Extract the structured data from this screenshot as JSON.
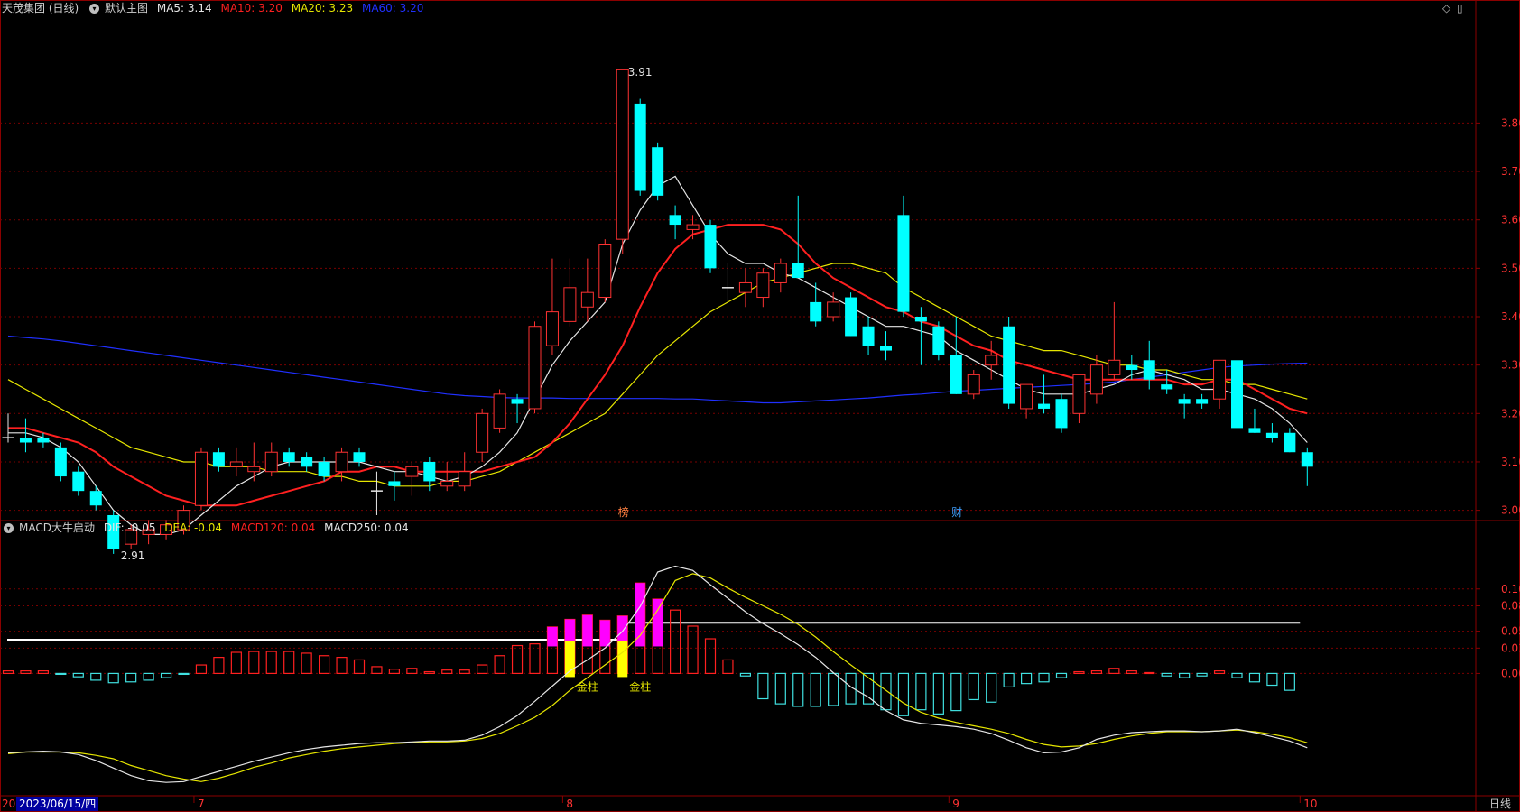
{
  "header": {
    "stock_name": "天茂集团 (日线)",
    "template": "默认主图",
    "ma5": "MA5: 3.14",
    "ma10": "MA10: 3.20",
    "ma20": "MA20: 3.23",
    "ma60": "MA60: 3.20"
  },
  "macd_header": {
    "name": "MACD大牛启动",
    "dif": "DIF: -0.05",
    "dea": "DEA: -0.04",
    "macd120": "MACD120: 0.04",
    "macd250": "MACD250: 0.04"
  },
  "footer": {
    "date_cursor": "2023/06/15/四",
    "period_label": "日线",
    "left_stub": "20"
  },
  "colors": {
    "up": "#ff3232",
    "down": "#00ffff",
    "ma5": "#e6e6e6",
    "ma10": "#ff2020",
    "ma20": "#e6e600",
    "ma60": "#2030ff",
    "hist_pos": "#ff2020",
    "hist_neg": "#40e0e0",
    "hist_mag": "#ff00ff",
    "hist_yel": "#ffff00"
  },
  "chart_data": [
    {
      "type": "candlestick",
      "title": "天茂集团 (日线)",
      "y_ticks": [
        3.0,
        3.1,
        3.2,
        3.3,
        3.4,
        3.5,
        3.6,
        3.7,
        3.8
      ],
      "ylim": [
        2.88,
        3.92
      ],
      "x_month_labels": [
        "7",
        "8",
        "9",
        "10"
      ],
      "annotations": {
        "max_label": "3.91",
        "min_label": "2.91",
        "marker_8": "榜",
        "marker_9": "财"
      },
      "candles_ohlc": [
        [
          3.15,
          3.2,
          3.14,
          3.15
        ],
        [
          3.15,
          3.19,
          3.12,
          3.14
        ],
        [
          3.15,
          3.16,
          3.13,
          3.14
        ],
        [
          3.13,
          3.14,
          3.06,
          3.07
        ],
        [
          3.08,
          3.09,
          3.03,
          3.04
        ],
        [
          3.04,
          3.05,
          3.0,
          3.01
        ],
        [
          2.99,
          3.0,
          2.91,
          2.92
        ],
        [
          2.93,
          2.97,
          2.92,
          2.96
        ],
        [
          2.95,
          2.98,
          2.93,
          2.96
        ],
        [
          2.95,
          2.98,
          2.94,
          2.97
        ],
        [
          2.96,
          3.01,
          2.95,
          3.0
        ],
        [
          3.01,
          3.13,
          3.0,
          3.12
        ],
        [
          3.12,
          3.13,
          3.08,
          3.09
        ],
        [
          3.09,
          3.13,
          3.07,
          3.1
        ],
        [
          3.08,
          3.14,
          3.06,
          3.09
        ],
        [
          3.08,
          3.14,
          3.07,
          3.12
        ],
        [
          3.12,
          3.13,
          3.09,
          3.1
        ],
        [
          3.11,
          3.12,
          3.08,
          3.09
        ],
        [
          3.1,
          3.11,
          3.06,
          3.07
        ],
        [
          3.08,
          3.13,
          3.06,
          3.12
        ],
        [
          3.12,
          3.13,
          3.09,
          3.1
        ],
        [
          3.04,
          3.08,
          2.99,
          3.04
        ],
        [
          3.06,
          3.08,
          3.02,
          3.05
        ],
        [
          3.07,
          3.1,
          3.03,
          3.09
        ],
        [
          3.1,
          3.11,
          3.04,
          3.06
        ],
        [
          3.05,
          3.1,
          3.04,
          3.06
        ],
        [
          3.05,
          3.12,
          3.04,
          3.08
        ],
        [
          3.12,
          3.21,
          3.1,
          3.2
        ],
        [
          3.17,
          3.25,
          3.16,
          3.24
        ],
        [
          3.23,
          3.24,
          3.18,
          3.22
        ],
        [
          3.21,
          3.39,
          3.2,
          3.38
        ],
        [
          3.34,
          3.52,
          3.32,
          3.41
        ],
        [
          3.39,
          3.52,
          3.38,
          3.46
        ],
        [
          3.42,
          3.52,
          3.39,
          3.45
        ],
        [
          3.44,
          3.56,
          3.43,
          3.55
        ],
        [
          3.56,
          3.9,
          3.53,
          3.91
        ],
        [
          3.84,
          3.85,
          3.65,
          3.66
        ],
        [
          3.75,
          3.76,
          3.64,
          3.65
        ],
        [
          3.61,
          3.63,
          3.56,
          3.59
        ],
        [
          3.58,
          3.61,
          3.56,
          3.59
        ],
        [
          3.59,
          3.6,
          3.49,
          3.5
        ],
        [
          3.46,
          3.51,
          3.43,
          3.46
        ],
        [
          3.45,
          3.5,
          3.42,
          3.47
        ],
        [
          3.44,
          3.5,
          3.42,
          3.49
        ],
        [
          3.47,
          3.52,
          3.45,
          3.51
        ],
        [
          3.51,
          3.65,
          3.48,
          3.48
        ],
        [
          3.43,
          3.47,
          3.38,
          3.39
        ],
        [
          3.4,
          3.45,
          3.39,
          3.43
        ],
        [
          3.44,
          3.45,
          3.36,
          3.36
        ],
        [
          3.38,
          3.4,
          3.32,
          3.34
        ],
        [
          3.34,
          3.37,
          3.31,
          3.33
        ],
        [
          3.61,
          3.65,
          3.4,
          3.41
        ],
        [
          3.4,
          3.42,
          3.3,
          3.39
        ],
        [
          3.38,
          3.39,
          3.31,
          3.32
        ],
        [
          3.32,
          3.4,
          3.24,
          3.24
        ],
        [
          3.24,
          3.29,
          3.23,
          3.28
        ],
        [
          3.3,
          3.35,
          3.27,
          3.32
        ],
        [
          3.38,
          3.4,
          3.21,
          3.22
        ],
        [
          3.21,
          3.24,
          3.19,
          3.26
        ],
        [
          3.22,
          3.28,
          3.2,
          3.21
        ],
        [
          3.23,
          3.24,
          3.16,
          3.17
        ],
        [
          3.2,
          3.22,
          3.18,
          3.28
        ],
        [
          3.24,
          3.32,
          3.22,
          3.3
        ],
        [
          3.28,
          3.43,
          3.27,
          3.31
        ],
        [
          3.3,
          3.32,
          3.27,
          3.29
        ],
        [
          3.31,
          3.35,
          3.25,
          3.27
        ],
        [
          3.26,
          3.29,
          3.24,
          3.25
        ],
        [
          3.23,
          3.24,
          3.19,
          3.22
        ],
        [
          3.23,
          3.24,
          3.21,
          3.22
        ],
        [
          3.23,
          3.27,
          3.21,
          3.31
        ],
        [
          3.31,
          3.33,
          3.17,
          3.17
        ],
        [
          3.17,
          3.21,
          3.16,
          3.16
        ],
        [
          3.16,
          3.18,
          3.14,
          3.15
        ],
        [
          3.16,
          3.17,
          3.12,
          3.12
        ],
        [
          3.12,
          3.13,
          3.05,
          3.09
        ]
      ],
      "ma5": [
        3.16,
        3.16,
        3.15,
        3.13,
        3.1,
        3.05,
        3.0,
        2.97,
        2.95,
        2.95,
        2.96,
        2.99,
        3.02,
        3.05,
        3.07,
        3.09,
        3.1,
        3.1,
        3.1,
        3.1,
        3.1,
        3.09,
        3.08,
        3.08,
        3.07,
        3.06,
        3.07,
        3.09,
        3.12,
        3.16,
        3.23,
        3.3,
        3.35,
        3.39,
        3.43,
        3.55,
        3.62,
        3.67,
        3.69,
        3.63,
        3.57,
        3.53,
        3.51,
        3.51,
        3.49,
        3.48,
        3.46,
        3.44,
        3.42,
        3.4,
        3.38,
        3.38,
        3.37,
        3.36,
        3.33,
        3.31,
        3.29,
        3.27,
        3.25,
        3.24,
        3.24,
        3.24,
        3.25,
        3.26,
        3.28,
        3.29,
        3.28,
        3.27,
        3.25,
        3.25,
        3.24,
        3.23,
        3.21,
        3.18,
        3.14
      ],
      "ma10": [
        3.17,
        3.17,
        3.16,
        3.15,
        3.14,
        3.12,
        3.09,
        3.07,
        3.05,
        3.03,
        3.02,
        3.01,
        3.01,
        3.01,
        3.02,
        3.03,
        3.04,
        3.05,
        3.06,
        3.08,
        3.08,
        3.09,
        3.09,
        3.08,
        3.08,
        3.08,
        3.08,
        3.08,
        3.09,
        3.1,
        3.11,
        3.14,
        3.18,
        3.23,
        3.28,
        3.34,
        3.42,
        3.49,
        3.54,
        3.57,
        3.58,
        3.59,
        3.59,
        3.59,
        3.58,
        3.55,
        3.51,
        3.48,
        3.46,
        3.44,
        3.42,
        3.41,
        3.39,
        3.38,
        3.36,
        3.34,
        3.33,
        3.31,
        3.3,
        3.29,
        3.28,
        3.27,
        3.27,
        3.27,
        3.27,
        3.27,
        3.27,
        3.26,
        3.26,
        3.27,
        3.27,
        3.25,
        3.23,
        3.21,
        3.2
      ],
      "ma20": [
        3.27,
        3.25,
        3.23,
        3.21,
        3.19,
        3.17,
        3.15,
        3.13,
        3.12,
        3.11,
        3.1,
        3.1,
        3.09,
        3.09,
        3.09,
        3.08,
        3.08,
        3.08,
        3.07,
        3.07,
        3.06,
        3.06,
        3.05,
        3.05,
        3.05,
        3.06,
        3.06,
        3.07,
        3.08,
        3.1,
        3.12,
        3.14,
        3.16,
        3.18,
        3.2,
        3.24,
        3.28,
        3.32,
        3.35,
        3.38,
        3.41,
        3.43,
        3.45,
        3.47,
        3.48,
        3.49,
        3.5,
        3.51,
        3.51,
        3.5,
        3.49,
        3.46,
        3.44,
        3.42,
        3.4,
        3.38,
        3.36,
        3.35,
        3.34,
        3.33,
        3.33,
        3.32,
        3.31,
        3.3,
        3.3,
        3.29,
        3.29,
        3.28,
        3.27,
        3.27,
        3.26,
        3.26,
        3.25,
        3.24,
        3.23
      ],
      "ma60": [
        3.36,
        3.357,
        3.354,
        3.35,
        3.345,
        3.34,
        3.335,
        3.33,
        3.325,
        3.32,
        3.315,
        3.31,
        3.305,
        3.3,
        3.295,
        3.29,
        3.285,
        3.28,
        3.275,
        3.27,
        3.265,
        3.26,
        3.255,
        3.25,
        3.245,
        3.24,
        3.237,
        3.235,
        3.233,
        3.232,
        3.232,
        3.232,
        3.231,
        3.231,
        3.231,
        3.231,
        3.231,
        3.231,
        3.23,
        3.23,
        3.228,
        3.226,
        3.224,
        3.222,
        3.222,
        3.224,
        3.226,
        3.228,
        3.23,
        3.232,
        3.235,
        3.238,
        3.24,
        3.243,
        3.246,
        3.248,
        3.25,
        3.252,
        3.254,
        3.256,
        3.258,
        3.26,
        3.262,
        3.265,
        3.27,
        3.275,
        3.28,
        3.285,
        3.29,
        3.295,
        3.298,
        3.3,
        3.302,
        3.303,
        3.304
      ]
    },
    {
      "type": "bar",
      "title": "MACD大牛启动",
      "y_ticks": [
        0.0,
        0.03,
        0.05,
        0.08,
        0.1
      ],
      "ylim": [
        -0.148,
        0.135
      ],
      "annotations": {
        "golden_bar": "金柱"
      },
      "macd120_level_first": 0.04,
      "macd120_level_second": 0.06,
      "histogram": [
        0.003,
        0.003,
        0.003,
        -0.001,
        -0.004,
        -0.008,
        -0.011,
        -0.01,
        -0.008,
        -0.005,
        -0.001,
        0.01,
        0.019,
        0.025,
        0.026,
        0.026,
        0.026,
        0.024,
        0.021,
        0.019,
        0.016,
        0.008,
        0.005,
        0.006,
        0.002,
        0.004,
        0.004,
        0.01,
        0.021,
        0.033,
        0.035,
        0.055,
        0.064,
        0.069,
        0.063,
        0.068,
        0.107,
        0.088,
        0.075,
        0.056,
        0.041,
        0.016,
        -0.003
      ],
      "histogram_second": [
        -0.03,
        -0.036,
        -0.039,
        -0.039,
        -0.038,
        -0.036,
        -0.036,
        -0.043,
        -0.05,
        -0.043,
        -0.048,
        -0.044,
        -0.031,
        -0.034,
        -0.016,
        -0.012,
        -0.01,
        -0.005,
        0.002,
        0.003,
        0.006,
        0.003,
        0.001,
        -0.003,
        -0.005,
        -0.003,
        0.003,
        -0.005,
        -0.01,
        -0.014,
        -0.02
      ],
      "dif": [
        -0.094,
        -0.093,
        -0.092,
        -0.093,
        -0.096,
        -0.103,
        -0.112,
        -0.121,
        -0.127,
        -0.129,
        -0.128,
        -0.122,
        -0.116,
        -0.11,
        -0.104,
        -0.099,
        -0.094,
        -0.09,
        -0.087,
        -0.085,
        -0.083,
        -0.082,
        -0.082,
        -0.081,
        -0.08,
        -0.08,
        -0.079,
        -0.073,
        -0.063,
        -0.05,
        -0.033,
        -0.015,
        0.003,
        0.016,
        0.03,
        0.05,
        0.079,
        0.12,
        0.127,
        0.122,
        0.105,
        0.089,
        0.073,
        0.059,
        0.047,
        0.034,
        0.019,
        0.001,
        -0.016,
        -0.028,
        -0.044,
        -0.055,
        -0.059,
        -0.061,
        -0.063,
        -0.066,
        -0.071,
        -0.079,
        -0.088,
        -0.094,
        -0.093,
        -0.088,
        -0.078,
        -0.073,
        -0.07,
        -0.069,
        -0.068,
        -0.068,
        -0.069,
        -0.068,
        -0.066,
        -0.07,
        -0.075,
        -0.08,
        -0.088
      ],
      "dea": [
        -0.095,
        -0.093,
        -0.093,
        -0.093,
        -0.094,
        -0.097,
        -0.101,
        -0.109,
        -0.115,
        -0.121,
        -0.125,
        -0.128,
        -0.124,
        -0.118,
        -0.111,
        -0.106,
        -0.1,
        -0.096,
        -0.092,
        -0.089,
        -0.087,
        -0.085,
        -0.083,
        -0.082,
        -0.081,
        -0.081,
        -0.08,
        -0.077,
        -0.071,
        -0.062,
        -0.052,
        -0.038,
        -0.02,
        -0.005,
        0.01,
        0.025,
        0.045,
        0.075,
        0.11,
        0.118,
        0.113,
        0.101,
        0.09,
        0.08,
        0.07,
        0.058,
        0.043,
        0.026,
        0.01,
        -0.005,
        -0.02,
        -0.035,
        -0.046,
        -0.053,
        -0.058,
        -0.062,
        -0.066,
        -0.071,
        -0.078,
        -0.084,
        -0.087,
        -0.086,
        -0.083,
        -0.078,
        -0.074,
        -0.071,
        -0.069,
        -0.069,
        -0.069,
        -0.068,
        -0.067,
        -0.069,
        -0.072,
        -0.076,
        -0.082
      ]
    }
  ]
}
